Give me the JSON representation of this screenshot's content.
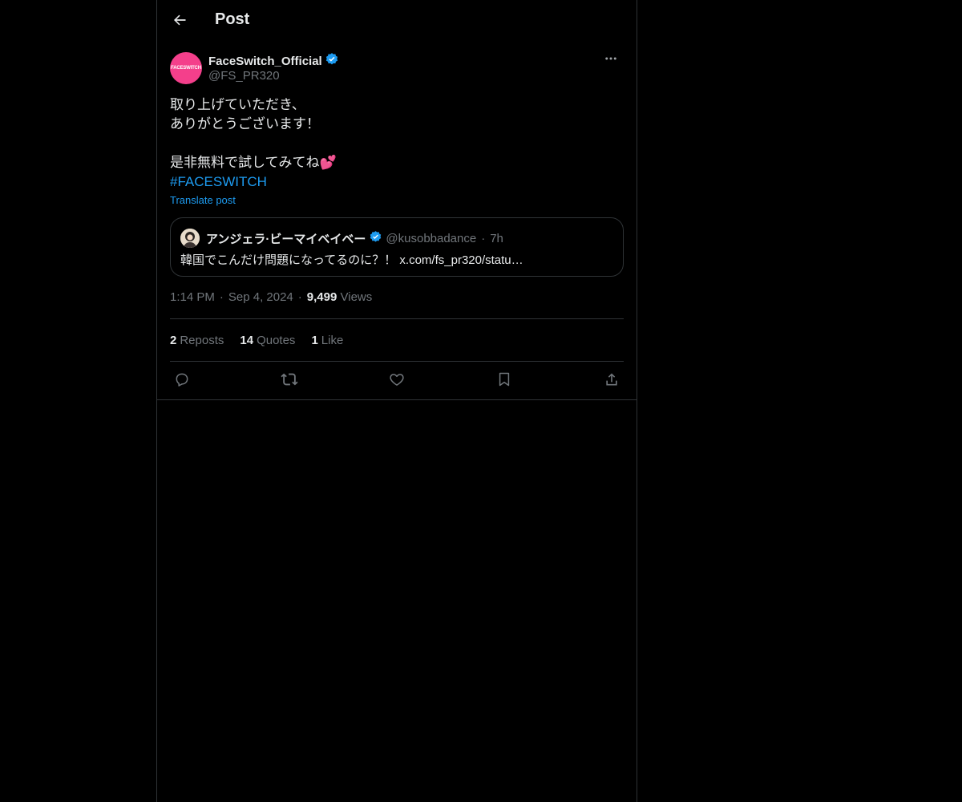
{
  "header": {
    "title": "Post"
  },
  "author": {
    "display_name": "FaceSwitch_Official",
    "handle": "@FS_PR320",
    "avatar_text": "FACESWITCH",
    "verified": true
  },
  "tweet": {
    "lines": [
      "取り上げていただき、",
      "ありがとうございます！",
      "",
      "是非無料で試してみてね💕"
    ],
    "hashtag": "#FACESWITCH",
    "translate_label": "Translate post"
  },
  "quote": {
    "display_name": "アンジェラ·ビーマイベイベー",
    "handle": "@kusobbadance",
    "dot": "·",
    "time": "7h",
    "text": "韓国でこんだけ問題になってるのに？！ x.com/fs_pr320/statu…"
  },
  "meta": {
    "time": "1:14 PM",
    "date": "Sep 4, 2024",
    "dot": "·",
    "views_count": "9,499",
    "views_label": "Views"
  },
  "stats": {
    "reposts_count": "2",
    "reposts_label": "Reposts",
    "quotes_count": "14",
    "quotes_label": "Quotes",
    "likes_count": "1",
    "likes_label": "Like"
  },
  "icons": {
    "back": "back-arrow-icon",
    "more": "more-icon",
    "verified": "verified-badge-icon",
    "reply": "reply-icon",
    "repost": "repost-icon",
    "like": "heart-icon",
    "bookmark": "bookmark-icon",
    "share": "share-icon"
  },
  "colors": {
    "background": "#000000",
    "accent": "#1d9bf0",
    "muted": "#71767b",
    "border": "#2f3336",
    "avatar": "#f43f8b"
  }
}
